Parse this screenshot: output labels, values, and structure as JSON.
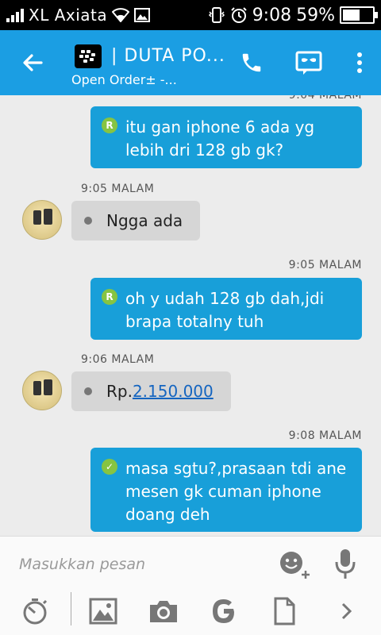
{
  "status": {
    "carrier": "XL Axiata",
    "time": "9:08",
    "battery": "59%",
    "battery_level": 0.59
  },
  "header": {
    "title": "| DUTA PO...",
    "subtitle": "Open Order± -..."
  },
  "messages": [
    {
      "direction": "out",
      "timestamp": "9:04 MALAM",
      "status_icon": "read-r",
      "text_lines": [
        "itu gan iphone 6 ada yg",
        "lebih dri 128 gb gk?"
      ]
    },
    {
      "direction": "in",
      "timestamp": "9:05 MALAM",
      "text": "Ngga ada"
    },
    {
      "direction": "out",
      "timestamp": "9:05 MALAM",
      "status_icon": "read-r",
      "text_lines": [
        "oh y udah 128 gb dah,jdi",
        "brapa totalny tuh"
      ]
    },
    {
      "direction": "in",
      "timestamp": "9:06 MALAM",
      "prefix": "Rp.",
      "link": "2.150.000"
    },
    {
      "direction": "out",
      "timestamp": "9:08 MALAM",
      "status_icon": "check",
      "text_lines": [
        "masa sgtu?,prasaan tdi ane",
        "mesen gk cuman iphone",
        "doang deh"
      ]
    }
  ],
  "composer": {
    "placeholder": "Masukkan pesan"
  },
  "colors": {
    "appbar": "#1b9ee3",
    "bubble_out": "#189fd9",
    "bubble_in": "#d6d6d6",
    "tick": "#86c442"
  }
}
